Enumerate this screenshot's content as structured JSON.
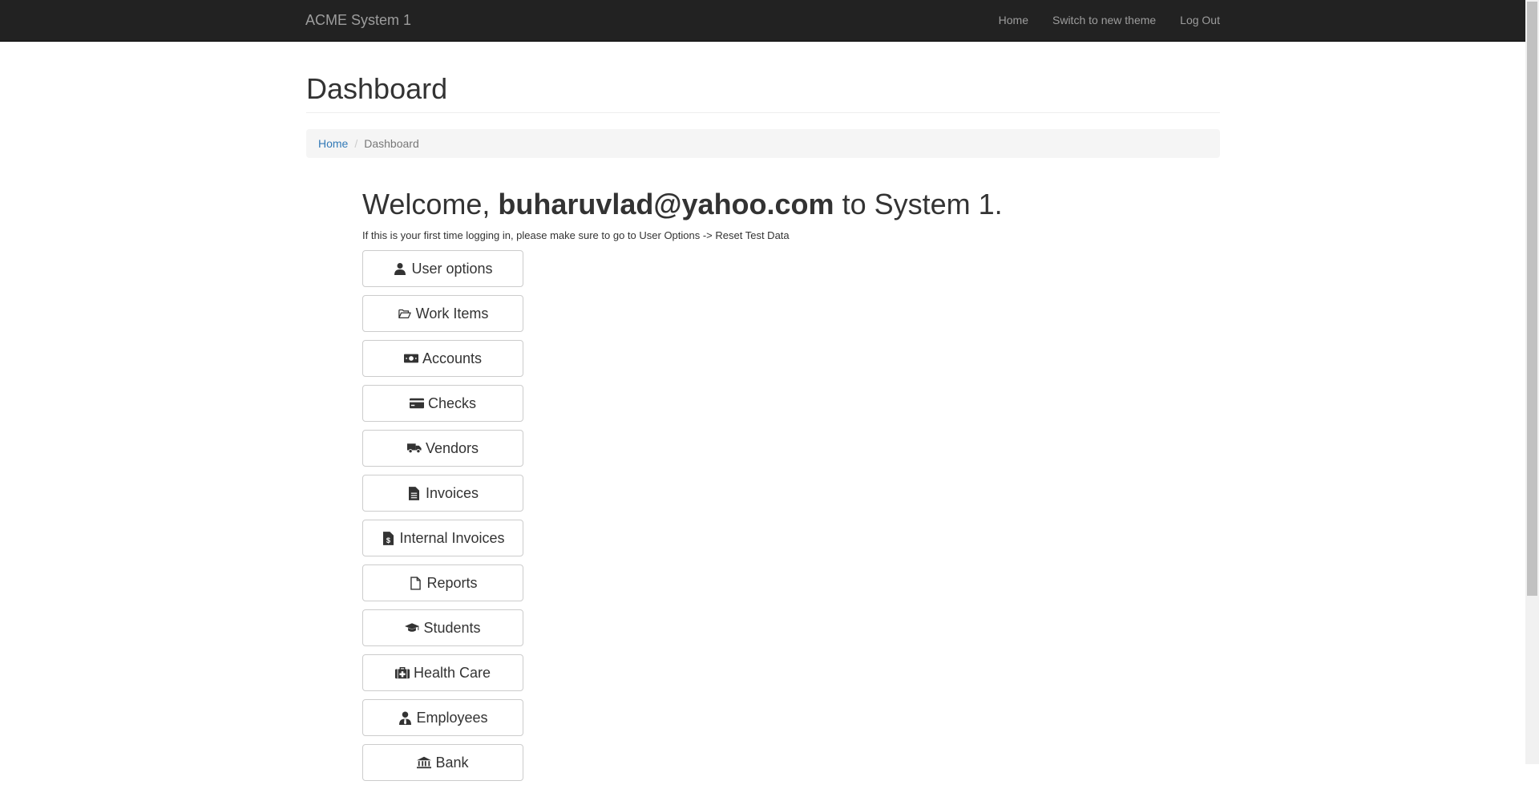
{
  "navbar": {
    "brand": "ACME System 1",
    "links": [
      "Home",
      "Switch to new theme",
      "Log Out"
    ]
  },
  "page": {
    "title": "Dashboard"
  },
  "breadcrumb": {
    "home": "Home",
    "separator": "/",
    "current": "Dashboard"
  },
  "welcome": {
    "prefix": "Welcome, ",
    "user": "buharuvlad@yahoo.com",
    "suffix": " to System 1.",
    "hint": "If this is your first time logging in, please make sure to go to User Options -> Reset Test Data"
  },
  "menu": [
    {
      "label": "User options",
      "icon": "user-icon"
    },
    {
      "label": "Work Items",
      "icon": "folder-open-icon"
    },
    {
      "label": "Accounts",
      "icon": "money-icon"
    },
    {
      "label": "Checks",
      "icon": "credit-card-icon"
    },
    {
      "label": "Vendors",
      "icon": "truck-icon"
    },
    {
      "label": "Invoices",
      "icon": "file-text-icon"
    },
    {
      "label": "Internal Invoices",
      "icon": "file-invoice-dollar-icon"
    },
    {
      "label": "Reports",
      "icon": "file-icon"
    },
    {
      "label": "Students",
      "icon": "graduation-cap-icon"
    },
    {
      "label": "Health Care",
      "icon": "medkit-icon"
    },
    {
      "label": "Employees",
      "icon": "user-tie-icon"
    },
    {
      "label": "Bank",
      "icon": "bank-icon"
    }
  ],
  "colors": {
    "navbar_bg": "#222222",
    "navbar_text": "#9d9d9d",
    "link": "#337ab7",
    "breadcrumb_bg": "#f5f5f5"
  }
}
